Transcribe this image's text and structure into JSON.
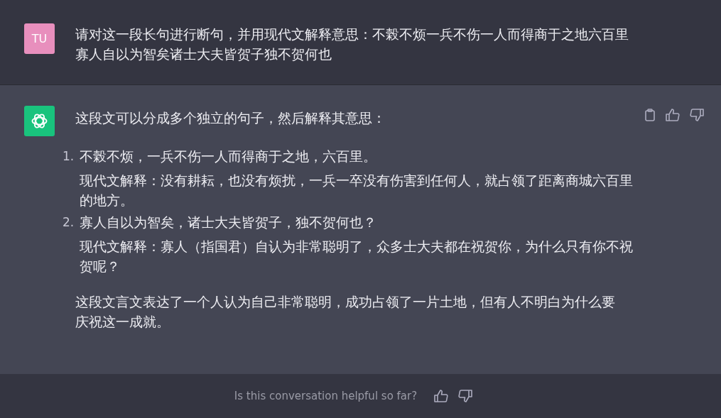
{
  "user_message": {
    "avatar": "TU",
    "text": "请对这一段长句进行断句，并用现代文解释意思：不榖不烦一兵不伤一人而得商于之地六百里寡人自以为智矣诸士大夫皆贺子独不贺何也"
  },
  "assistant_message": {
    "intro": "这段文可以分成多个独立的句子，然后解释其意思：",
    "items": [
      {
        "number": "1.",
        "sentence": "不榖不烦，一兵不伤一人而得商于之地，六百里。",
        "explanation": "现代文解释：没有耕耘，也没有烦扰，一兵一卒没有伤害到任何人，就占领了距离商城六百里的地方。"
      },
      {
        "number": "2.",
        "sentence": "寡人自以为智矣，诸士大夫皆贺子，独不贺何也？",
        "explanation": "现代文解释：寡人（指国君）自认为非常聪明了，众多士大夫都在祝贺你，为什么只有你不祝贺呢？"
      }
    ],
    "conclusion": "这段文言文表达了一个人认为自己非常聪明，成功占领了一片土地，但有人不明白为什么要庆祝这一成就。"
  },
  "footer": {
    "prompt": "Is this conversation helpful so far?"
  }
}
